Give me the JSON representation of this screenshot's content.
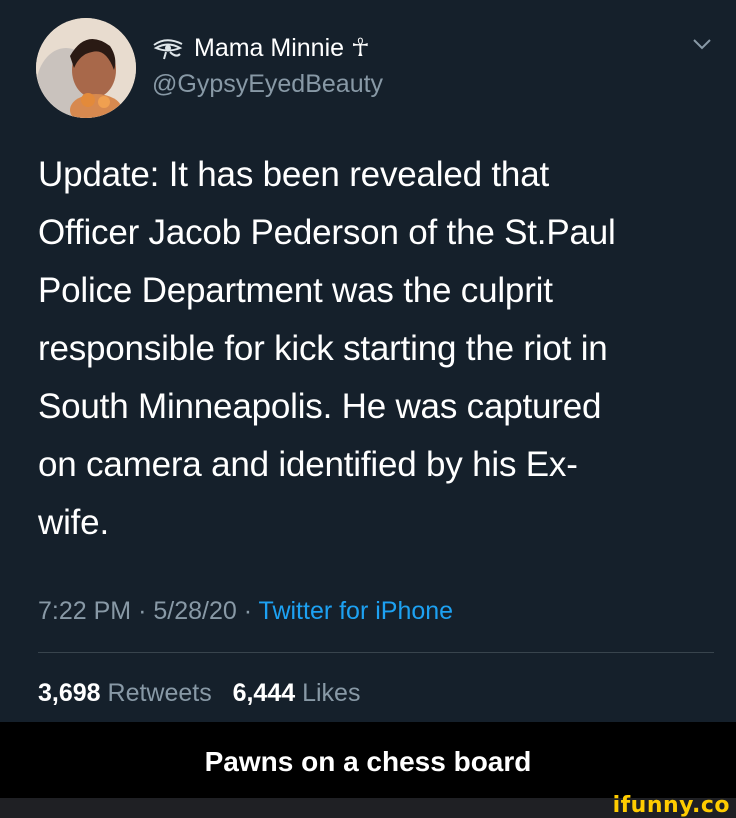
{
  "tweet": {
    "display_name": "Mama Minnie ☥",
    "handle": "@GypsyEyedBeauty",
    "text_lines": [
      "Update: It has been revealed that",
      "Officer Jacob Pederson of the St.Paul",
      "Police Department was the culprit",
      "responsible for kick starting the riot in",
      "South Minneapolis. He was captured",
      "on camera and identified by his Ex-",
      "wife."
    ],
    "time": "7:22 PM",
    "date": "5/28/20",
    "separator": "·",
    "source": "Twitter for iPhone",
    "retweets_count": "3,698",
    "retweets_label": "Retweets",
    "likes_count": "6,444",
    "likes_label": "Likes"
  },
  "caption": "Pawns on a chess board",
  "watermark": "ifunny.co",
  "icons": {
    "name_prefix": "eye-of-horus-icon",
    "menu": "chevron-down-icon",
    "avatar": "avatar"
  },
  "colors": {
    "background": "#15202b",
    "text": "#ffffff",
    "secondary": "#8899a6",
    "link": "#1da1f2",
    "divider": "#38444d",
    "caption_bg": "#000000",
    "watermark": "#ffcc00"
  }
}
